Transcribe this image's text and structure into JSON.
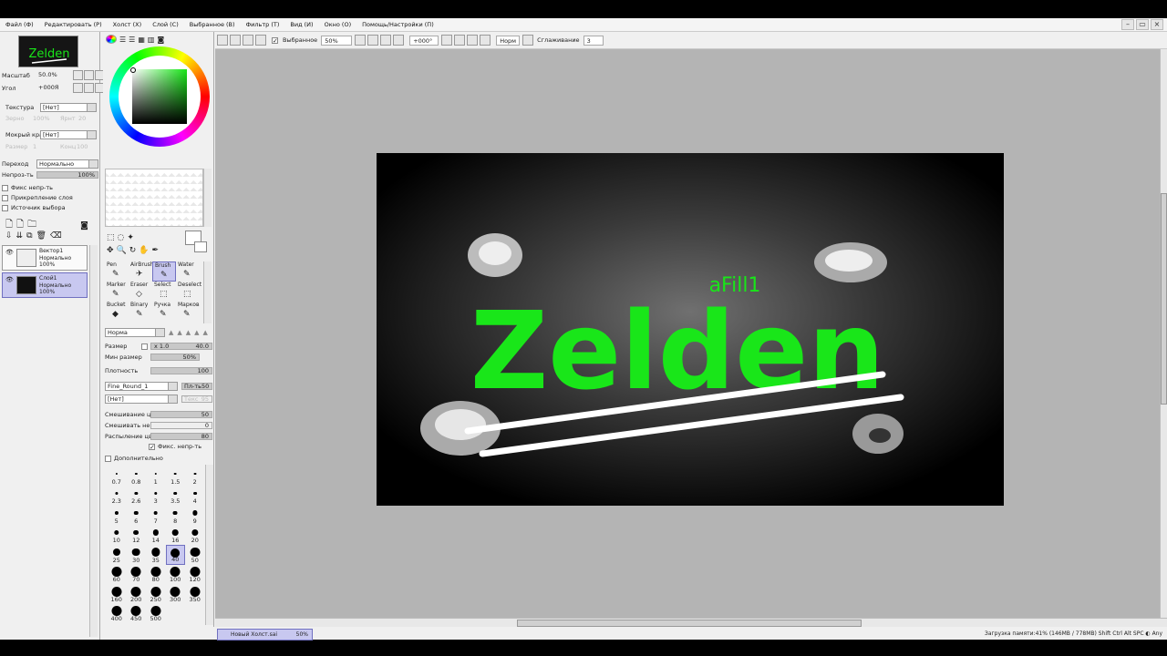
{
  "menu": [
    "Файл (Ф)",
    "Редактировать (Р)",
    "Холст (Х)",
    "Слой (С)",
    "Выбранное (В)",
    "Фильтр (Т)",
    "Вид (И)",
    "Окно (О)",
    "Помощь/Настройки (П)"
  ],
  "window_controls": [
    "–",
    "▭",
    "×"
  ],
  "navigator": {
    "thumb_text": "Zelden",
    "zoom_label": "Масштаб",
    "zoom_value": "50.0%",
    "angle_label": "Угол",
    "angle_value": "+000Я"
  },
  "texture": {
    "label": "Текстура",
    "value": "[Нет]",
    "grain": "Зерно",
    "grain_val": "100%",
    "bright": "Ярнт",
    "bright_val": "20"
  },
  "wet_edge": {
    "label": "Мокрый край",
    "value": "[Нет]",
    "size": "Размер",
    "size_val": "1",
    "cons": "Конц",
    "cons_val": "100"
  },
  "blend": {
    "label": "Переход",
    "value": "Нормально",
    "opacity_label": "Непроз-ть",
    "opacity_value": "100%"
  },
  "layer_opts": [
    "Фикс непр-ть",
    "Прикрепление слоя",
    "Источник выбора"
  ],
  "layers": [
    {
      "name": "Вектор1",
      "mode": "Нормально",
      "opacity": "100%",
      "selected": false
    },
    {
      "name": "Слой1",
      "mode": "Нормально",
      "opacity": "100%",
      "selected": true
    }
  ],
  "tools": [
    {
      "label": "Pen",
      "icon": "✎"
    },
    {
      "label": "AirBrush",
      "icon": "✈"
    },
    {
      "label": "Brush",
      "icon": "✎",
      "selected": true
    },
    {
      "label": "Water",
      "icon": "✎"
    },
    {
      "label": "Marker",
      "icon": "✎"
    },
    {
      "label": "Eraser",
      "icon": "◇"
    },
    {
      "label": "Select",
      "icon": "⬚"
    },
    {
      "label": "Deselect",
      "icon": "⬚"
    },
    {
      "label": "Bucket",
      "icon": "◆"
    },
    {
      "label": "Binary",
      "icon": "✎"
    },
    {
      "label": "Ручка",
      "icon": "✎"
    },
    {
      "label": "Марков",
      "icon": "✎"
    }
  ],
  "brush": {
    "shape": "Норма",
    "size_label": "Размер",
    "size_mult": "x 1.0",
    "size_value": "40.0",
    "min_size_label": "Мин размер",
    "min_size_value": "50%",
    "density_label": "Плотность",
    "density_value": "100",
    "tex_name": "Fine_Round_1",
    "tex_btn": "Пл-ть",
    "tex_btn_val": "50",
    "tex2": "[Нет]",
    "tex2_lbl": "Текс",
    "tex2_val": "95",
    "mix_label": "Смешивание цвет",
    "mix_value": "50",
    "mix2_label": "Смешивать непрз",
    "mix2_value": "0",
    "spray_label": "Распыление цвет",
    "spray_value": "80",
    "fix_opacity": "Фикс. непр-ть",
    "extra": "Дополнительно"
  },
  "brush_sizes": [
    "0.7",
    "0.8",
    "1",
    "1.5",
    "2",
    "2.3",
    "2.6",
    "3",
    "3.5",
    "4",
    "5",
    "6",
    "7",
    "8",
    "9",
    "10",
    "12",
    "14",
    "16",
    "20",
    "25",
    "30",
    "35",
    "40",
    "50",
    "60",
    "70",
    "80",
    "100",
    "120",
    "160",
    "200",
    "250",
    "300",
    "350",
    "400",
    "450",
    "500"
  ],
  "toolbar": {
    "selection_label": "Выбранное",
    "zoom": "50%",
    "angle": "+000°",
    "mode": "Норм",
    "smooth_label": "Сглаживание",
    "smooth_value": "3"
  },
  "canvas_text": {
    "title": "Zelden",
    "small": "aFill1"
  },
  "file_tab": {
    "name": "Новый Холст.sai",
    "zoom": "50%"
  },
  "status": "Загрузка памяти:41% (146MB / 778MB)  Shift Ctrl Alt SPC ◐ Any",
  "colors": {
    "accent": "#c8c8f0",
    "green": "#19e619",
    "workspace": "#b4b4b4"
  }
}
